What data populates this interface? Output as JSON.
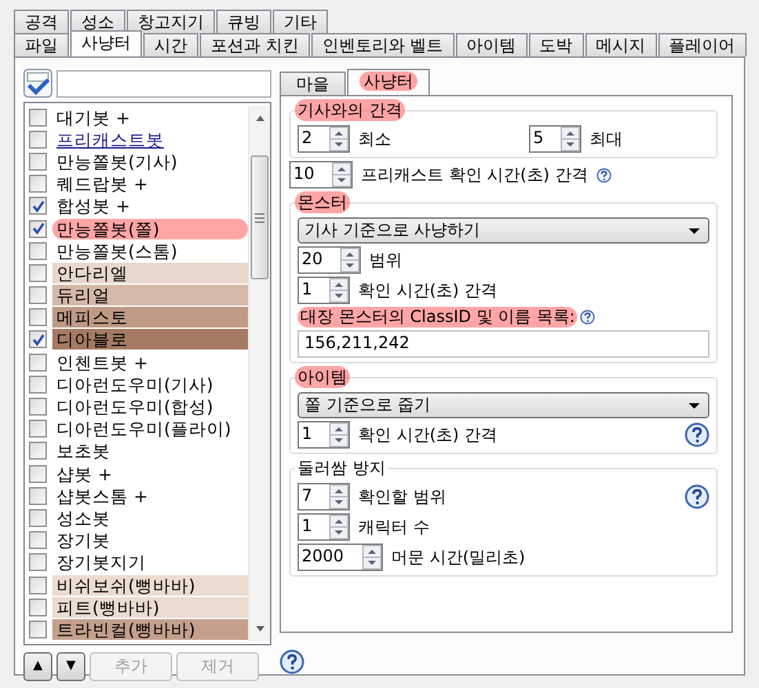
{
  "outer_tabs": [
    [
      {
        "label": "공격",
        "selected": false
      },
      {
        "label": "성소",
        "selected": false
      },
      {
        "label": "창고지기",
        "selected": false
      },
      {
        "label": "큐빙",
        "selected": false
      },
      {
        "label": "기타",
        "selected": false
      }
    ],
    [
      {
        "label": "파일",
        "selected": false
      },
      {
        "label": "사냥터",
        "selected": true
      },
      {
        "label": "시간",
        "selected": false
      },
      {
        "label": "포션과 치킨",
        "selected": false
      },
      {
        "label": "인벤토리와 벨트",
        "selected": false
      },
      {
        "label": "아이템",
        "selected": false
      },
      {
        "label": "도박",
        "selected": false
      },
      {
        "label": "메시지",
        "selected": false
      },
      {
        "label": "플레이어",
        "selected": false
      }
    ]
  ],
  "bot_list": [
    {
      "label": "대기봇 +",
      "checked": false,
      "kind": "plain",
      "highlighted": false
    },
    {
      "label": "프리캐스트봇",
      "checked": false,
      "kind": "link",
      "highlighted": false
    },
    {
      "label": "만능쫄봇(기사)",
      "checked": false,
      "kind": "plain",
      "highlighted": false
    },
    {
      "label": "퀘드랍봇 +",
      "checked": false,
      "kind": "plain",
      "highlighted": false
    },
    {
      "label": "합성봇 +",
      "checked": true,
      "kind": "plain",
      "highlighted": false
    },
    {
      "label": "만능쫄봇(쫄)",
      "checked": true,
      "kind": "plain",
      "highlighted": true
    },
    {
      "label": "만능쫄봇(스톰)",
      "checked": false,
      "kind": "plain",
      "highlighted": false
    },
    {
      "label": "안다리엘",
      "checked": false,
      "kind": "plain",
      "highlighted": false,
      "color": "#e8d8cc"
    },
    {
      "label": "듀리얼",
      "checked": false,
      "kind": "plain",
      "highlighted": false,
      "color": "#d4b9a8"
    },
    {
      "label": "메피스토",
      "checked": false,
      "kind": "plain",
      "highlighted": false,
      "color": "#bf9a85"
    },
    {
      "label": "디아블로",
      "checked": true,
      "kind": "plain",
      "highlighted": false,
      "color": "#a57a63"
    },
    {
      "label": "인첸트봇 +",
      "checked": false,
      "kind": "plain",
      "highlighted": false
    },
    {
      "label": "디아런도우미(기사)",
      "checked": false,
      "kind": "plain",
      "highlighted": false
    },
    {
      "label": "디아런도우미(합성)",
      "checked": false,
      "kind": "plain",
      "highlighted": false
    },
    {
      "label": "디아런도우미(플라이)",
      "checked": false,
      "kind": "plain",
      "highlighted": false
    },
    {
      "label": "보초봇",
      "checked": false,
      "kind": "plain",
      "highlighted": false
    },
    {
      "label": "샵봇 +",
      "checked": false,
      "kind": "plain",
      "highlighted": false
    },
    {
      "label": "샵봇스톰 +",
      "checked": false,
      "kind": "plain",
      "highlighted": false
    },
    {
      "label": "성소봇",
      "checked": false,
      "kind": "plain",
      "highlighted": false
    },
    {
      "label": "장기봇",
      "checked": false,
      "kind": "plain",
      "highlighted": false
    },
    {
      "label": "장기봇지기",
      "checked": false,
      "kind": "plain",
      "highlighted": false
    },
    {
      "label": "비쉬보쉬(뻥바바)",
      "checked": false,
      "kind": "plain",
      "highlighted": false,
      "color": "#ecdcd0"
    },
    {
      "label": "피트(뻥바바)",
      "checked": false,
      "kind": "plain",
      "highlighted": false,
      "color": "#ecdcd0"
    },
    {
      "label": "트라빈컬(뻥바바)",
      "checked": false,
      "kind": "plain",
      "highlighted": false,
      "color": "#c4a08c"
    }
  ],
  "list_buttons": [
    {
      "label": "▲",
      "disabled": false
    },
    {
      "label": "▼",
      "disabled": false
    },
    {
      "label": "추가",
      "disabled": true
    },
    {
      "label": "제거",
      "disabled": true
    }
  ],
  "sub_tabs": [
    {
      "label": "마을",
      "selected": false,
      "highlighted": false
    },
    {
      "label": "사냥터",
      "selected": true,
      "highlighted": true
    }
  ],
  "blocks": [
    {
      "kind": "group",
      "title": "기사와의 간격",
      "highlighted": true,
      "rows": [
        {
          "kind": "spinners",
          "fields": [
            {
              "value": "2",
              "label": "최소"
            },
            {
              "value": "5",
              "label": "최대"
            }
          ]
        }
      ]
    },
    {
      "kind": "spinners",
      "fields": [
        {
          "value": "10",
          "label": "프리캐스트 확인 시간(초) 간격",
          "help": true,
          "help_at_right": false
        }
      ]
    },
    {
      "kind": "group",
      "title": "몬스터",
      "highlighted": true,
      "rows": [
        {
          "kind": "select",
          "value": "기사 기준으로 사냥하기"
        },
        {
          "kind": "spinners",
          "fields": [
            {
              "value": "20",
              "label": "범위"
            }
          ]
        },
        {
          "kind": "spinners",
          "fields": [
            {
              "value": "1",
              "label": "확인 시간(초) 간격"
            }
          ]
        },
        {
          "kind": "caption",
          "text": "대장 몬스터의 ClassID 및 이름 목록:",
          "highlighted": true,
          "help": true
        },
        {
          "kind": "text_field",
          "value": "156,211,242"
        }
      ]
    },
    {
      "kind": "group",
      "title": "아이템",
      "highlighted": true,
      "rows": [
        {
          "kind": "select",
          "value": "쫄 기준으로 줍기"
        },
        {
          "kind": "spinners",
          "fields": [
            {
              "value": "1",
              "label": "확인 시간(초) 간격",
              "help": true,
              "help_at_right": true
            }
          ]
        }
      ]
    },
    {
      "kind": "group",
      "title": "둘러쌈 방지",
      "highlighted": false,
      "rows": [
        {
          "kind": "spinners",
          "fields": [
            {
              "value": "7",
              "label": "확인할 범위",
              "help": true,
              "help_at_right": true
            }
          ]
        },
        {
          "kind": "spinners",
          "fields": [
            {
              "value": "1",
              "label": "캐릭터 수"
            }
          ]
        },
        {
          "kind": "spinners",
          "fields": [
            {
              "value": "2000",
              "label": "머문 시간(밀리초)"
            }
          ]
        }
      ]
    }
  ]
}
